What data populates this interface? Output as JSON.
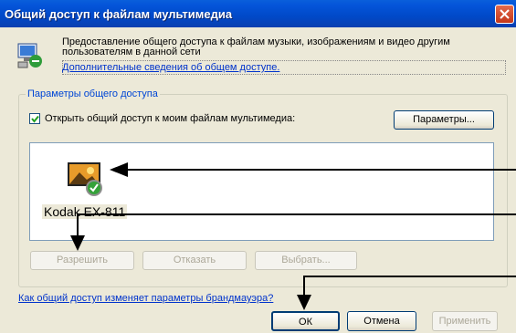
{
  "window": {
    "title": "Общий доступ к файлам мультимедиа"
  },
  "info": {
    "text": "Предоставление общего доступа к файлам музыки, изображениям и видео другим пользователям в данной сети",
    "more_link": "Дополнительные сведения об общем доступе."
  },
  "sharing": {
    "group_label": "Параметры общего доступа",
    "checkbox_label": "Открыть общий доступ к моим файлам мультимедиа:",
    "checkbox_checked": true,
    "settings_button": "Параметры...",
    "device_name": "Kodak EX-811",
    "allow_button": "Разрешить",
    "deny_button": "Отказать",
    "customize_button": "Выбрать..."
  },
  "footer": {
    "firewall_link": "Как общий доступ изменяет параметры брандмауэра?",
    "ok_button": "ОК",
    "cancel_button": "Отмена",
    "apply_button": "Применить"
  },
  "icons": {
    "info": "media-sharing-icon",
    "device": "photo-frame-device-icon",
    "close": "close-icon"
  },
  "colors": {
    "title_bar": "#0454d9",
    "close_button": "#c4371a",
    "link": "#0033cc",
    "group_label": "#0046d5"
  }
}
